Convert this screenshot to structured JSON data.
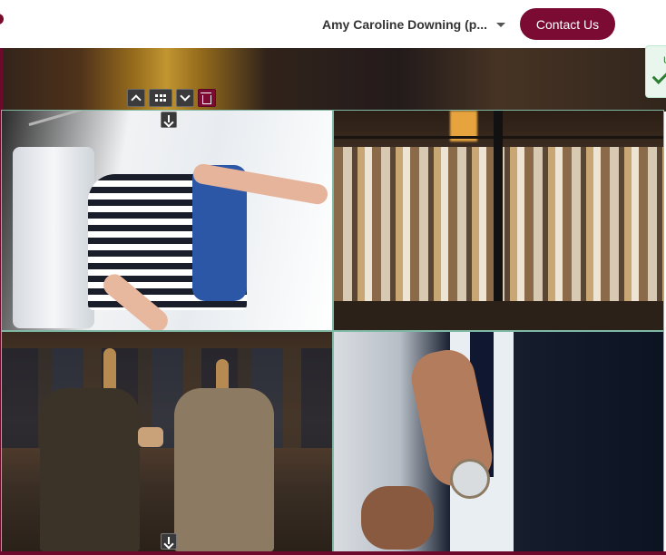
{
  "header": {
    "account_label": "Amy Caroline Downing (p...",
    "contact_button": "Contact Us"
  },
  "toast": {
    "text": "U"
  },
  "toolbar": {
    "buttons": [
      "chevron-up-icon",
      "grid-icon",
      "chevron-down-icon",
      "trash-icon"
    ]
  },
  "gallery": {
    "tiles": [
      "hand-browsing-striped-shirts",
      "clothing-rack-in-store",
      "mannequins-in-suits",
      "man-adjusting-tie-with-watch"
    ]
  },
  "colors": {
    "brand": "#7b0b33",
    "success": "#2e7d32",
    "tile_outline": "#7fb9a5"
  }
}
